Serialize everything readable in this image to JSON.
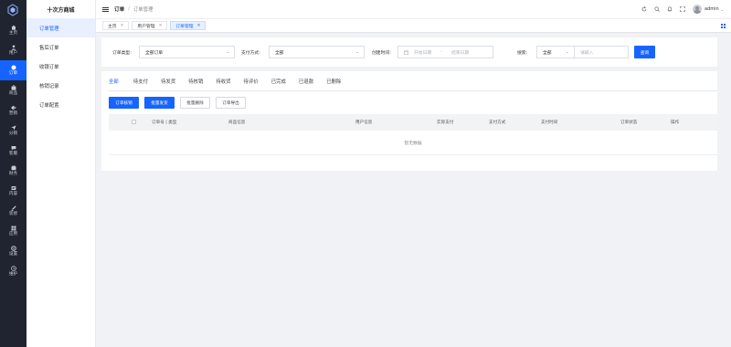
{
  "rail": {
    "items": [
      {
        "label": "主页",
        "icon": "home-icon"
      },
      {
        "label": "用户",
        "icon": "user-icon"
      },
      {
        "label": "订单",
        "icon": "order-icon",
        "active": true
      },
      {
        "label": "商品",
        "icon": "goods-icon"
      },
      {
        "label": "营销",
        "icon": "marketing-icon"
      },
      {
        "label": "分销",
        "icon": "distribution-icon"
      },
      {
        "label": "客服",
        "icon": "service-icon"
      },
      {
        "label": "财务",
        "icon": "finance-icon"
      },
      {
        "label": "内容",
        "icon": "content-icon"
      },
      {
        "label": "装修",
        "icon": "decorate-icon"
      },
      {
        "label": "应用",
        "icon": "apps-icon"
      },
      {
        "label": "设置",
        "icon": "settings-icon"
      },
      {
        "label": "维护",
        "icon": "maintenance-icon"
      }
    ]
  },
  "submenu": {
    "brand": "十次方商城",
    "items": [
      {
        "label": "订单管理",
        "active": true
      },
      {
        "label": "售后订单"
      },
      {
        "label": "收银订单"
      },
      {
        "label": "核销记录"
      },
      {
        "label": "订单配置"
      }
    ]
  },
  "header": {
    "breadcrumb_root": "订单",
    "breadcrumb_sep": "/",
    "breadcrumb_current": "订单管理",
    "username": "admin"
  },
  "page_tabs": [
    {
      "label": "主页"
    },
    {
      "label": "用户管理"
    },
    {
      "label": "订单管理",
      "active": true
    }
  ],
  "filters": {
    "order_type_label": "订单类型:",
    "order_type_value": "全部订单",
    "pay_method_label": "支付方式:",
    "pay_method_value": "全部",
    "created_label": "创建时间:",
    "start_placeholder": "开始日期",
    "date_sep": "-",
    "end_placeholder": "结束日期",
    "search_label": "搜索:",
    "search_scope_value": "全部",
    "search_placeholder": "请输入",
    "query_button": "查询"
  },
  "status_tabs": [
    "全部",
    "待支付",
    "待发货",
    "待核销",
    "待收货",
    "待评价",
    "已完成",
    "已退款",
    "已删除"
  ],
  "actions": {
    "verify": "订单核销",
    "batch_ship": "批量发货",
    "batch_delete": "批量删除",
    "export": "订单导出"
  },
  "table": {
    "columns": [
      "订单号 | 类型",
      "商品信息",
      "用户信息",
      "实际支付",
      "支付方式",
      "支付时间",
      "订单状态",
      "操作"
    ],
    "empty_text": "暂无数据"
  },
  "colors": {
    "primary": "#1664ff",
    "rail_bg": "#1f2430",
    "page_bg": "#f0f2f5"
  }
}
